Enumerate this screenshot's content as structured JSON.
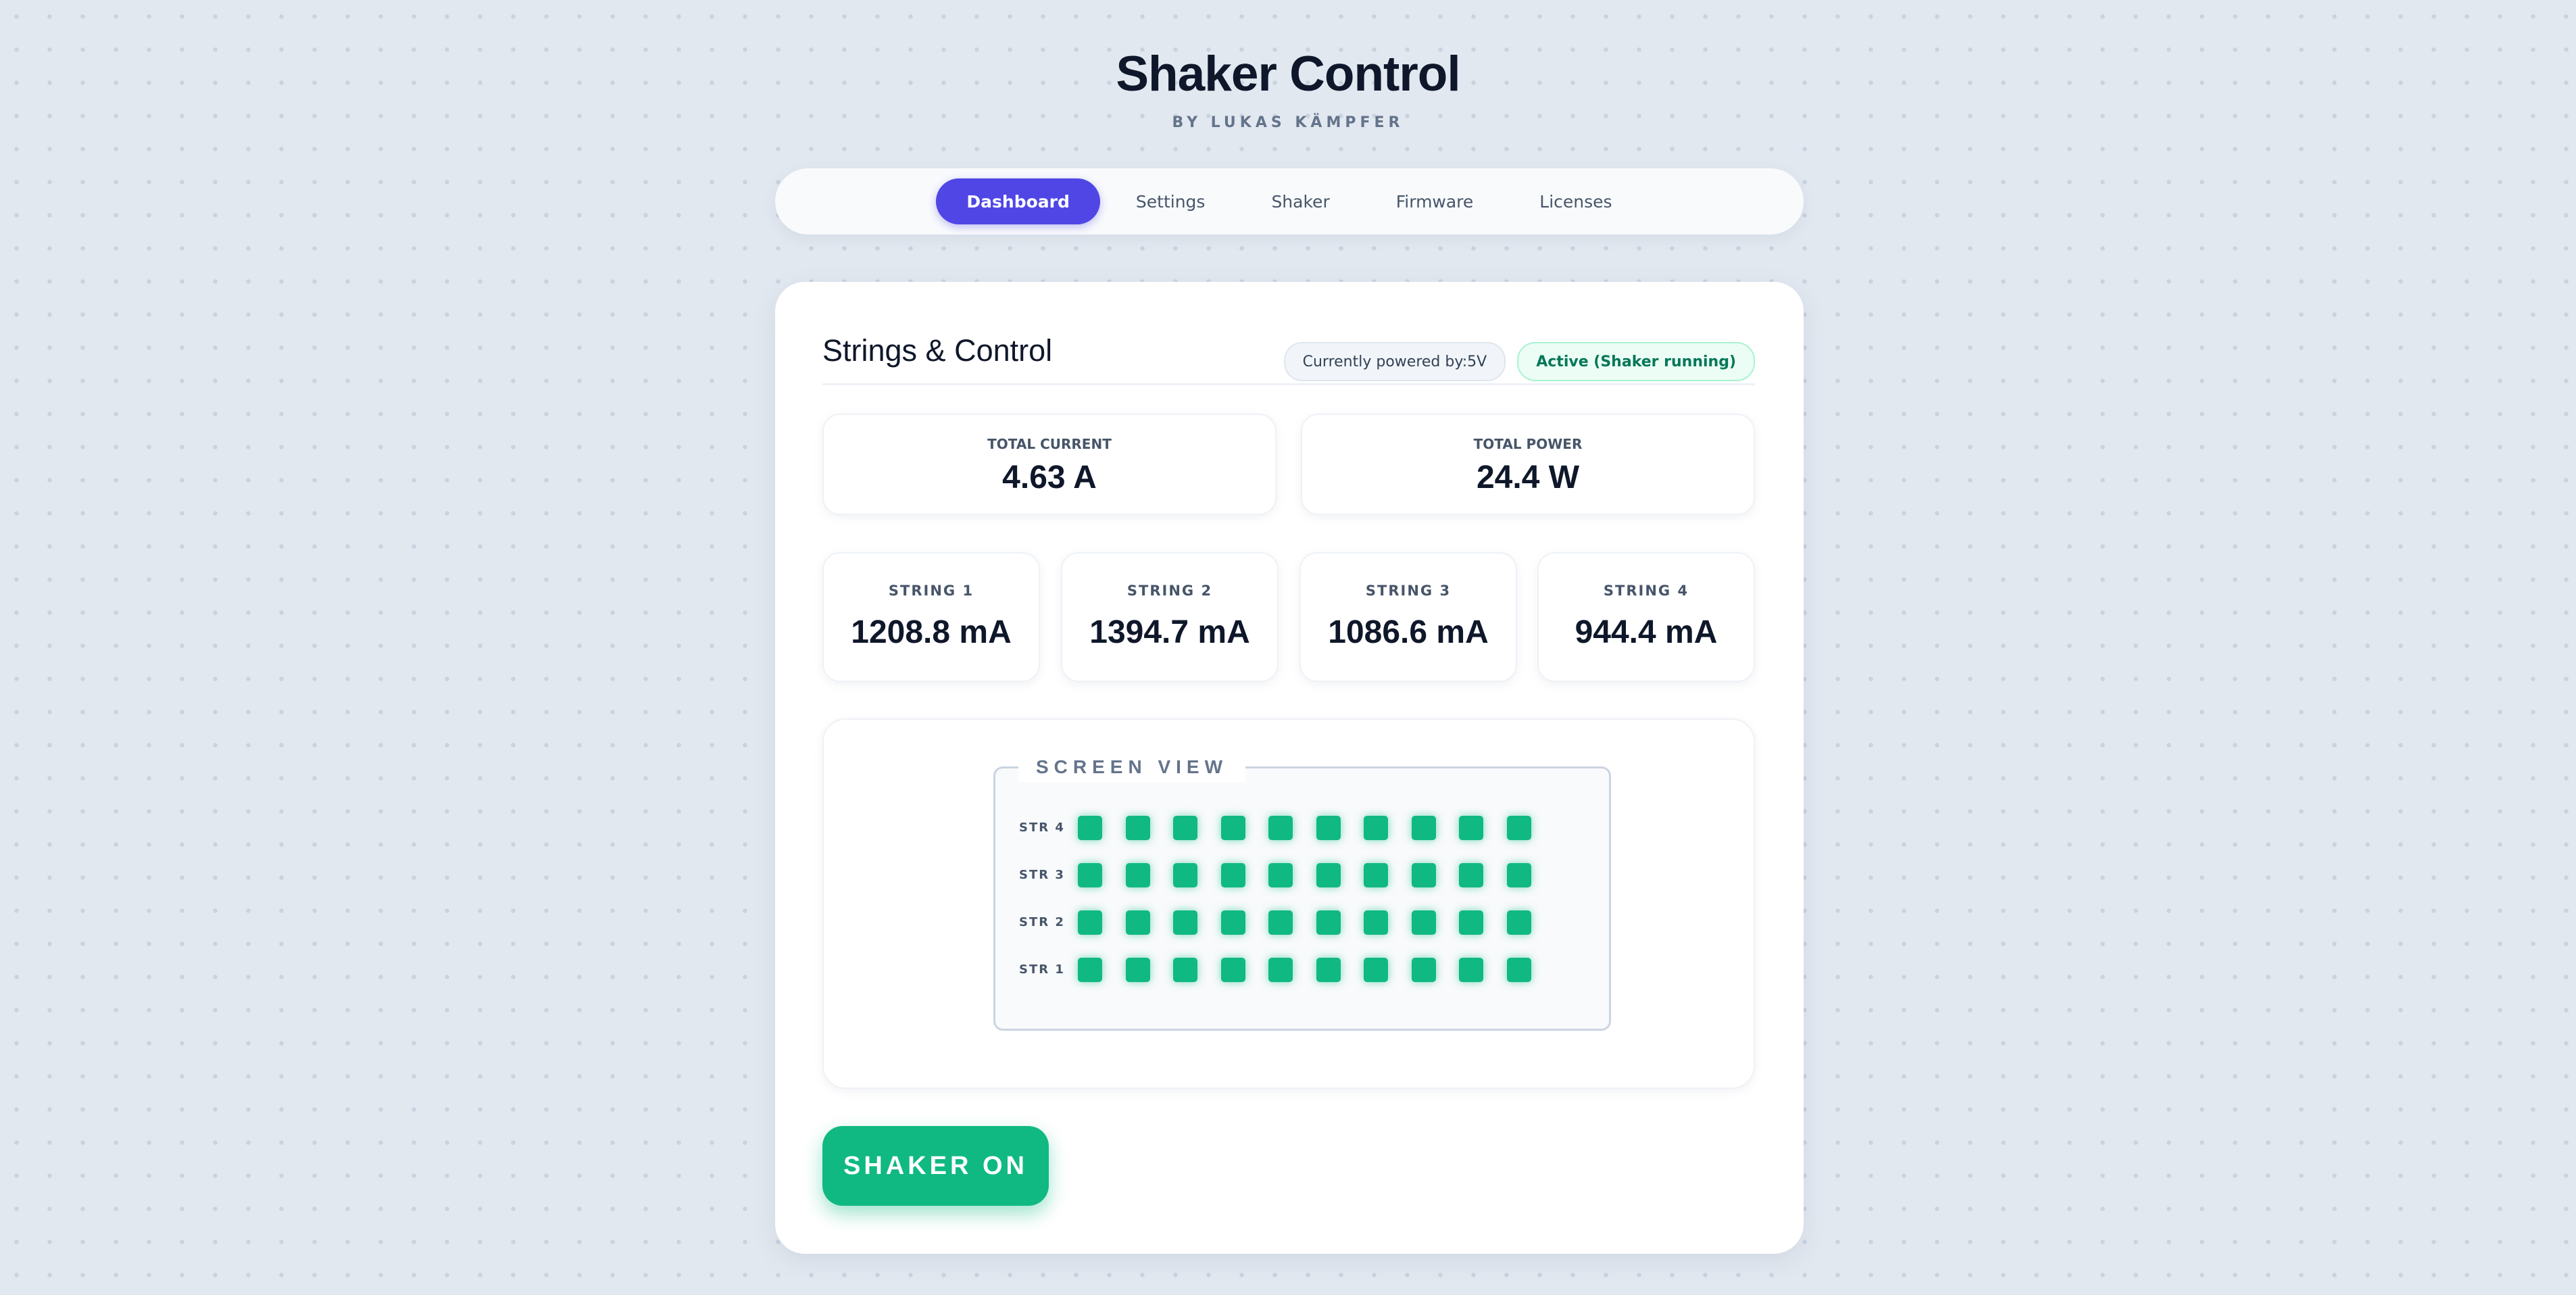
{
  "header": {
    "title": "Shaker Control",
    "subtitle": "BY LUKAS KÄMPFER"
  },
  "nav": {
    "active": "Dashboard",
    "tabs": [
      {
        "label": "Dashboard"
      },
      {
        "label": "Settings"
      },
      {
        "label": "Shaker"
      },
      {
        "label": "Firmware"
      },
      {
        "label": "Licenses"
      }
    ]
  },
  "section": {
    "title": "Strings & Control",
    "power_badge": "Currently powered by:5V",
    "status_badge": "Active (Shaker running)"
  },
  "totals": {
    "current": {
      "label": "TOTAL CURRENT",
      "value": "4.63 A"
    },
    "power": {
      "label": "TOTAL POWER",
      "value": "24.4 W"
    }
  },
  "strings": [
    {
      "label": "STRING 1",
      "value": "1208.8 mA"
    },
    {
      "label": "STRING 2",
      "value": "1394.7 mA"
    },
    {
      "label": "STRING 3",
      "value": "1086.6 mA"
    },
    {
      "label": "STRING 4",
      "value": "944.4 mA"
    }
  ],
  "screen_view": {
    "legend": "SCREEN VIEW",
    "rows": [
      {
        "label": "STR 4",
        "panels": 10,
        "active": 10
      },
      {
        "label": "STR 3",
        "panels": 10,
        "active": 10
      },
      {
        "label": "STR 2",
        "panels": 10,
        "active": 10
      },
      {
        "label": "STR 1",
        "panels": 10,
        "active": 10
      }
    ]
  },
  "shaker_button": {
    "label": "SHAKER ON"
  },
  "colors": {
    "accent": "#4f46e5",
    "active_green": "#10b981",
    "status_text": "#047857"
  }
}
